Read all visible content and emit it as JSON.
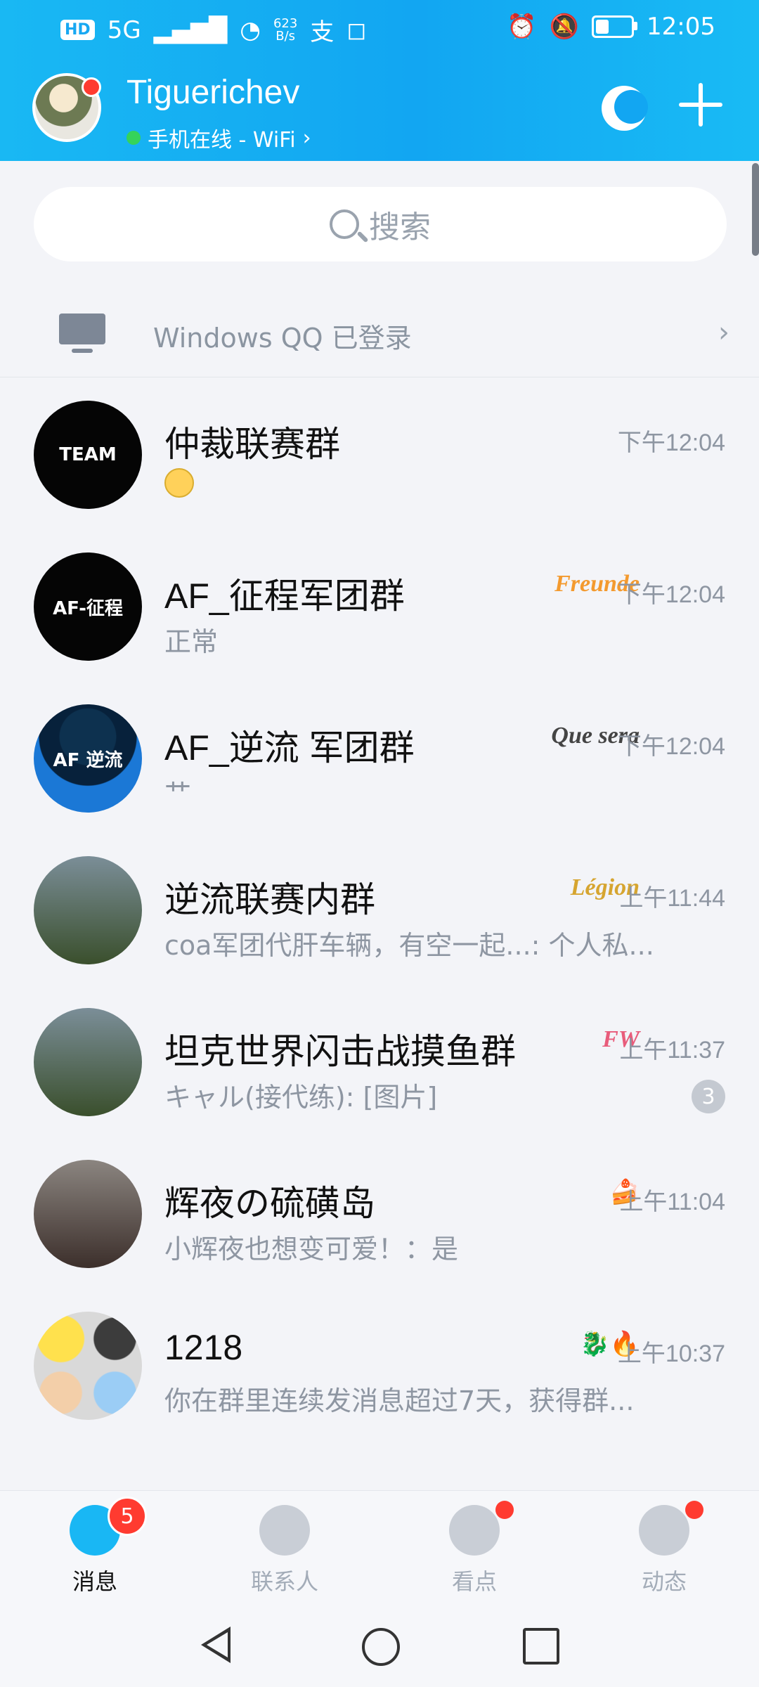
{
  "status_bar": {
    "hd": "HD",
    "signal": "5G",
    "speed_top": "623",
    "speed_bottom": "B/s",
    "time": "12:05"
  },
  "header": {
    "username": "Tiguerichev",
    "online_status": "手机在线 - WiFi"
  },
  "search": {
    "placeholder": "搜索"
  },
  "device_notice": "Windows QQ 已登录",
  "chats": [
    {
      "title": "仲裁联赛群",
      "preview": "",
      "time": "下午12:04",
      "tag": "",
      "avatar_text": "TEAM"
    },
    {
      "title": "AF_征程军团群",
      "preview": "正常",
      "time": "下午12:04",
      "tag": "Freunde",
      "avatar_text": "AF-征程"
    },
    {
      "title": "AF_逆流 军团群",
      "preview": "艹",
      "time": "下午12:04",
      "tag": "Que sera",
      "avatar_text": "AF 逆流"
    },
    {
      "title": "逆流联赛内群",
      "preview": "coa军团代肝车辆，有空一起...: 个人私...",
      "time": "上午11:44",
      "tag": "Légion",
      "avatar_text": ""
    },
    {
      "title": "坦克世界闪击战摸鱼群",
      "preview": "キャル(接代练): [图片]",
      "time": "上午11:37",
      "tag": "FW",
      "badge": "3",
      "avatar_text": ""
    },
    {
      "title": "辉夜の硫磺岛",
      "preview": "小辉夜也想变可爱！：是",
      "time": "上午11:04",
      "tag": "🍰",
      "avatar_text": ""
    },
    {
      "title": "1218",
      "preview": "你在群里连续发消息超过7天，获得群...",
      "time": "上午10:37",
      "tag": "🐉🔥",
      "avatar_text": ""
    }
  ],
  "bottom_nav": [
    {
      "label": "消息",
      "badge": "5"
    },
    {
      "label": "联系人"
    },
    {
      "label": "看点"
    },
    {
      "label": "动态"
    }
  ]
}
